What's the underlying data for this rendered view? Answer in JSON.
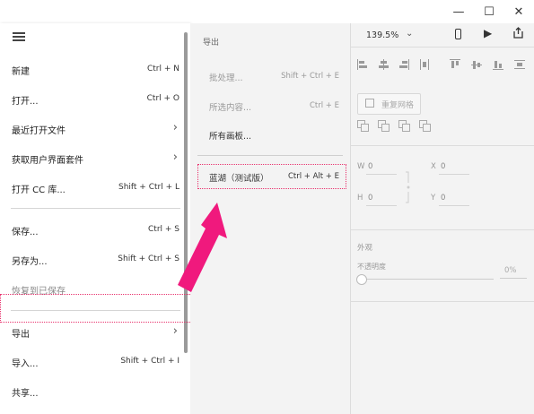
{
  "window": {
    "minimize": "—",
    "maximize": "☐",
    "close": "✕"
  },
  "menu": {
    "items": [
      {
        "label": "新建",
        "shortcut": "Ctrl + N"
      },
      {
        "label": "打开...",
        "shortcut": "Ctrl + O"
      },
      {
        "label": "最近打开文件",
        "arrow": "›"
      },
      {
        "label": "获取用户界面套件",
        "arrow": "›"
      },
      {
        "label": "打开 CC 库...",
        "shortcut": "Shift + Ctrl + L"
      },
      {
        "label": "保存...",
        "shortcut": "Ctrl + S"
      },
      {
        "label": "另存为...",
        "shortcut": "Shift + Ctrl + S"
      },
      {
        "label": "恢复到已保存"
      },
      {
        "label": "导出",
        "arrow": "›"
      },
      {
        "label": "导入...",
        "shortcut": "Shift + Ctrl + I"
      },
      {
        "label": "共享..."
      }
    ]
  },
  "submenu": {
    "header": "导出",
    "items": [
      {
        "label": "批处理...",
        "shortcut": "Shift + Ctrl + E"
      },
      {
        "label": "所选内容...",
        "shortcut": "Ctrl + E"
      },
      {
        "label": "所有画板..."
      },
      {
        "label": "蓝湖（测试版）",
        "shortcut": "Ctrl + Alt + E"
      }
    ]
  },
  "panel": {
    "zoom": "139.5%",
    "repeat_grid": "重复网格",
    "w_label": "W",
    "w_value": "0",
    "x_label": "X",
    "x_value": "0",
    "h_label": "H",
    "h_value": "0",
    "y_label": "Y",
    "y_value": "0",
    "appearance": "外观",
    "opacity_label": "不透明度",
    "opacity_value": "0%"
  },
  "colors": {
    "highlight": "#e8336e",
    "arrow": "#f0197d"
  }
}
